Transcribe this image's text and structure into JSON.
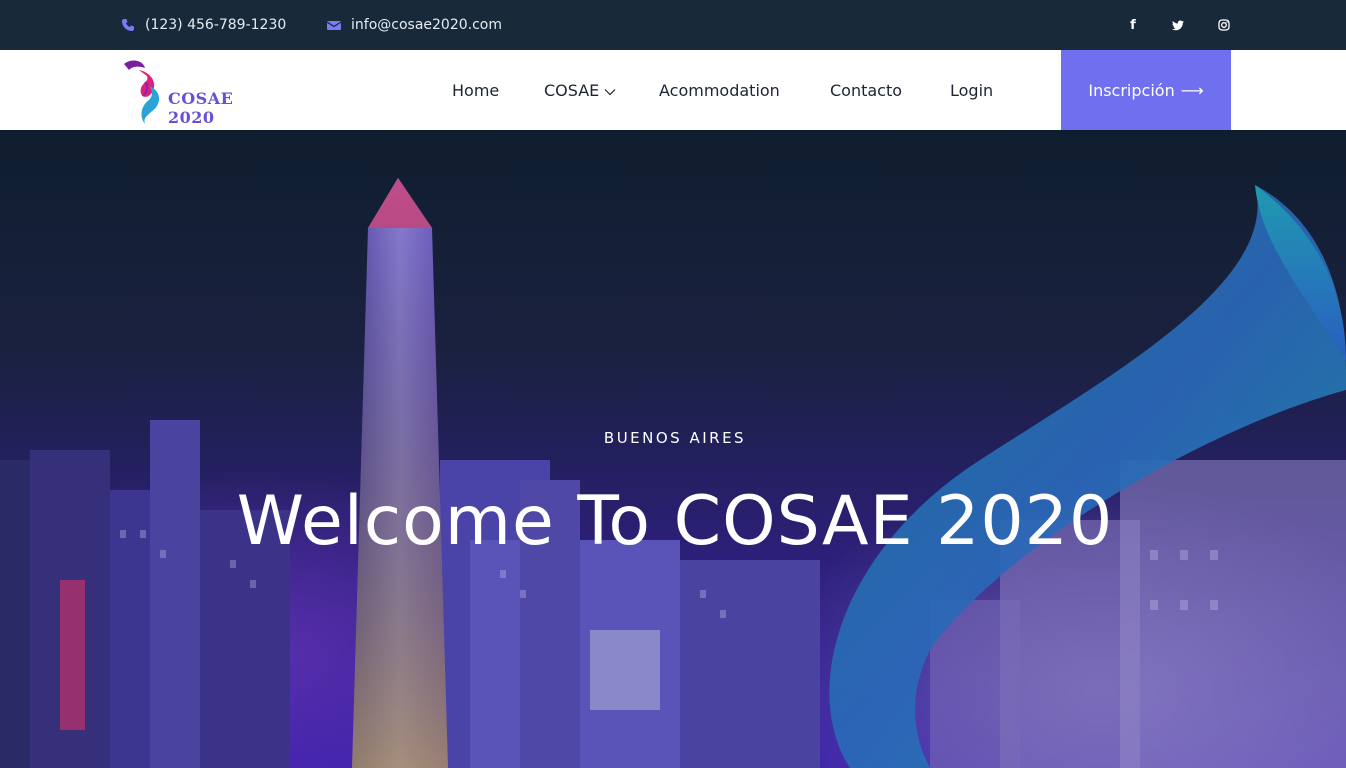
{
  "topbar": {
    "phone": "(123) 456-789-1230",
    "email": "info@cosae2020.com",
    "social": [
      {
        "icon": "facebook-icon",
        "glyph": "f"
      },
      {
        "icon": "twitter-icon",
        "glyph": "🐦"
      },
      {
        "icon": "instagram-icon",
        "glyph": "◎"
      }
    ]
  },
  "header": {
    "logo_text": "COSAE 2020",
    "nav": [
      {
        "label": "Home"
      },
      {
        "label": "COSAE"
      },
      {
        "label": "Acommodation"
      },
      {
        "label": "Contacto"
      },
      {
        "label": "Login"
      }
    ],
    "cta_label": "Inscripción",
    "cta_arrow": "⟶"
  },
  "hero": {
    "subtitle": "BUENOS AIRES",
    "title": "Welcome To COSAE 2020"
  },
  "colors": {
    "topbar_bg": "#182a3a",
    "accent": "#6f6ff0",
    "icon_accent": "#7b7bf5"
  }
}
